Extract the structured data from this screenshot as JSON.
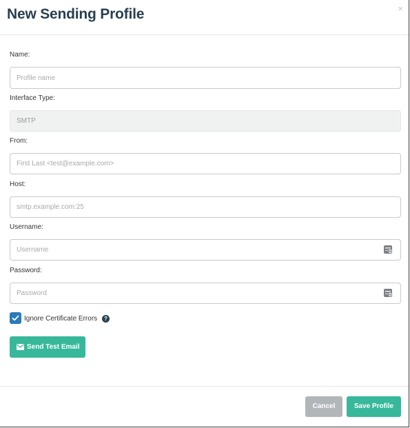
{
  "modal": {
    "title": "New Sending Profile",
    "close_glyph": "×"
  },
  "form": {
    "name": {
      "label": "Name:",
      "value": "",
      "placeholder": "Profile name"
    },
    "interface_type": {
      "label": "Interface Type:",
      "value": "SMTP"
    },
    "from": {
      "label": "From:",
      "value": "",
      "placeholder": "First Last <test@example.com>"
    },
    "host": {
      "label": "Host:",
      "value": "",
      "placeholder": "smtp.example.com:25"
    },
    "username": {
      "label": "Username:",
      "value": "",
      "placeholder": "Username",
      "icon": "key-manager-icon"
    },
    "password": {
      "label": "Password:",
      "value": "",
      "placeholder": "Password",
      "icon": "key-manager-icon"
    },
    "ignore_cert": {
      "label": "Ignore Certificate Errors",
      "checked": true,
      "help_glyph": "?"
    }
  },
  "buttons": {
    "send_test": "Send Test Email",
    "cancel": "Cancel",
    "save": "Save Profile"
  },
  "colors": {
    "accent": "#37b89a",
    "title": "#283f50",
    "checkbox": "#2d7ab8",
    "cancel": "#b3b6b9"
  }
}
